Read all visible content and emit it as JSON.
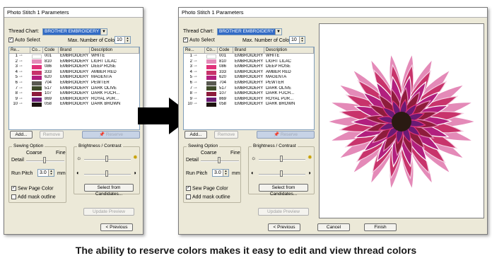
{
  "caption": "The ability to reserve colors makes it easy to edit and view thread colors",
  "colors": {
    "dialog_bg": "#ece9d8",
    "selection": "#316ac5",
    "arrow": "#000000",
    "reserve_button": "#c7d3e6"
  },
  "dialog": {
    "title": "Photo Stitch 1 Parameters",
    "thread_chart_label": "Thread Chart:",
    "thread_chart_value": "BROTHER EMBROIDERY",
    "auto_select_label": "Auto Select",
    "auto_select_checked": true,
    "max_colors_label": "Max. Number of Colors:",
    "max_colors_value": "10",
    "columns_left": [
      "Re...",
      "Co...",
      "Code",
      "Brand",
      "Description"
    ],
    "columns_right": [
      "Re...",
      "Co...",
      "Code",
      "Brand",
      "Description"
    ],
    "threads": [
      {
        "num": "1",
        "color": "#ffffff",
        "code": "001",
        "brand": "EMBROIDERY",
        "desc_left": "WHITE",
        "desc_right": "WHITE"
      },
      {
        "num": "2",
        "color": "#e48ab8",
        "code": "810",
        "brand": "EMBROIDERY",
        "desc_left": "LIGHT LILAC",
        "desc_right": "LIGHT LILAC"
      },
      {
        "num": "3",
        "color": "#e0317a",
        "code": "086",
        "brand": "EMBROIDERY",
        "desc_left": "DEEP ROSE",
        "desc_right": "DEEP ROSE"
      },
      {
        "num": "4",
        "color": "#c8336b",
        "code": "333",
        "brand": "EMBROIDERY",
        "desc_left": "AMBER RED",
        "desc_right": "AMBER RED"
      },
      {
        "num": "5",
        "color": "#b21f7e",
        "code": "620",
        "brand": "EMBROIDERY",
        "desc_left": "MAGENTA",
        "desc_right": "MAGENTA"
      },
      {
        "num": "6",
        "color": "#5a5a52",
        "code": "704",
        "brand": "EMBROIDERY",
        "desc_left": "PEWTER",
        "desc_right": "PEWTER"
      },
      {
        "num": "7",
        "color": "#3f4a2a",
        "code": "517",
        "brand": "EMBROIDERY",
        "desc_left": "DARK OLIVE",
        "desc_right": "DARK OLIVE"
      },
      {
        "num": "8",
        "color": "#8e1c3c",
        "code": "107",
        "brand": "EMBROIDERY",
        "desc_left": "DARK FUCH...",
        "desc_right": "DARK FUCH..."
      },
      {
        "num": "9",
        "color": "#6a1b74",
        "code": "869",
        "brand": "EMBROIDERY",
        "desc_left": "ROYAL PUR...",
        "desc_right": "ROYAL PUR..."
      },
      {
        "num": "10",
        "color": "#1e1410",
        "code": "058",
        "brand": "EMBROIDERY",
        "desc_left": "DARK BROWN",
        "desc_right": "DARK BROWN"
      }
    ],
    "add_button": "Add...",
    "remove_button": "Remove",
    "reserve_button": "Reserve",
    "sewing_option_title": "Sewing Option",
    "coarse_label": "Coarse",
    "fine_label": "Fine",
    "detail_label": "Detail",
    "run_pitch_label": "Run Pitch",
    "run_pitch_value": "3.0",
    "run_pitch_unit": "mm",
    "brightness_title": "Brightness / Contrast",
    "sew_page_color_label": "Sew Page Color",
    "sew_page_color_checked": true,
    "add_mask_outline_label": "Add mask outline",
    "add_mask_outline_checked": false,
    "select_candidates_button": "Select from Candidates...",
    "update_preview_button": "Update Preview",
    "previous_button": "< Previous",
    "cancel_button": "Cancel",
    "finish_button": "Finish"
  }
}
